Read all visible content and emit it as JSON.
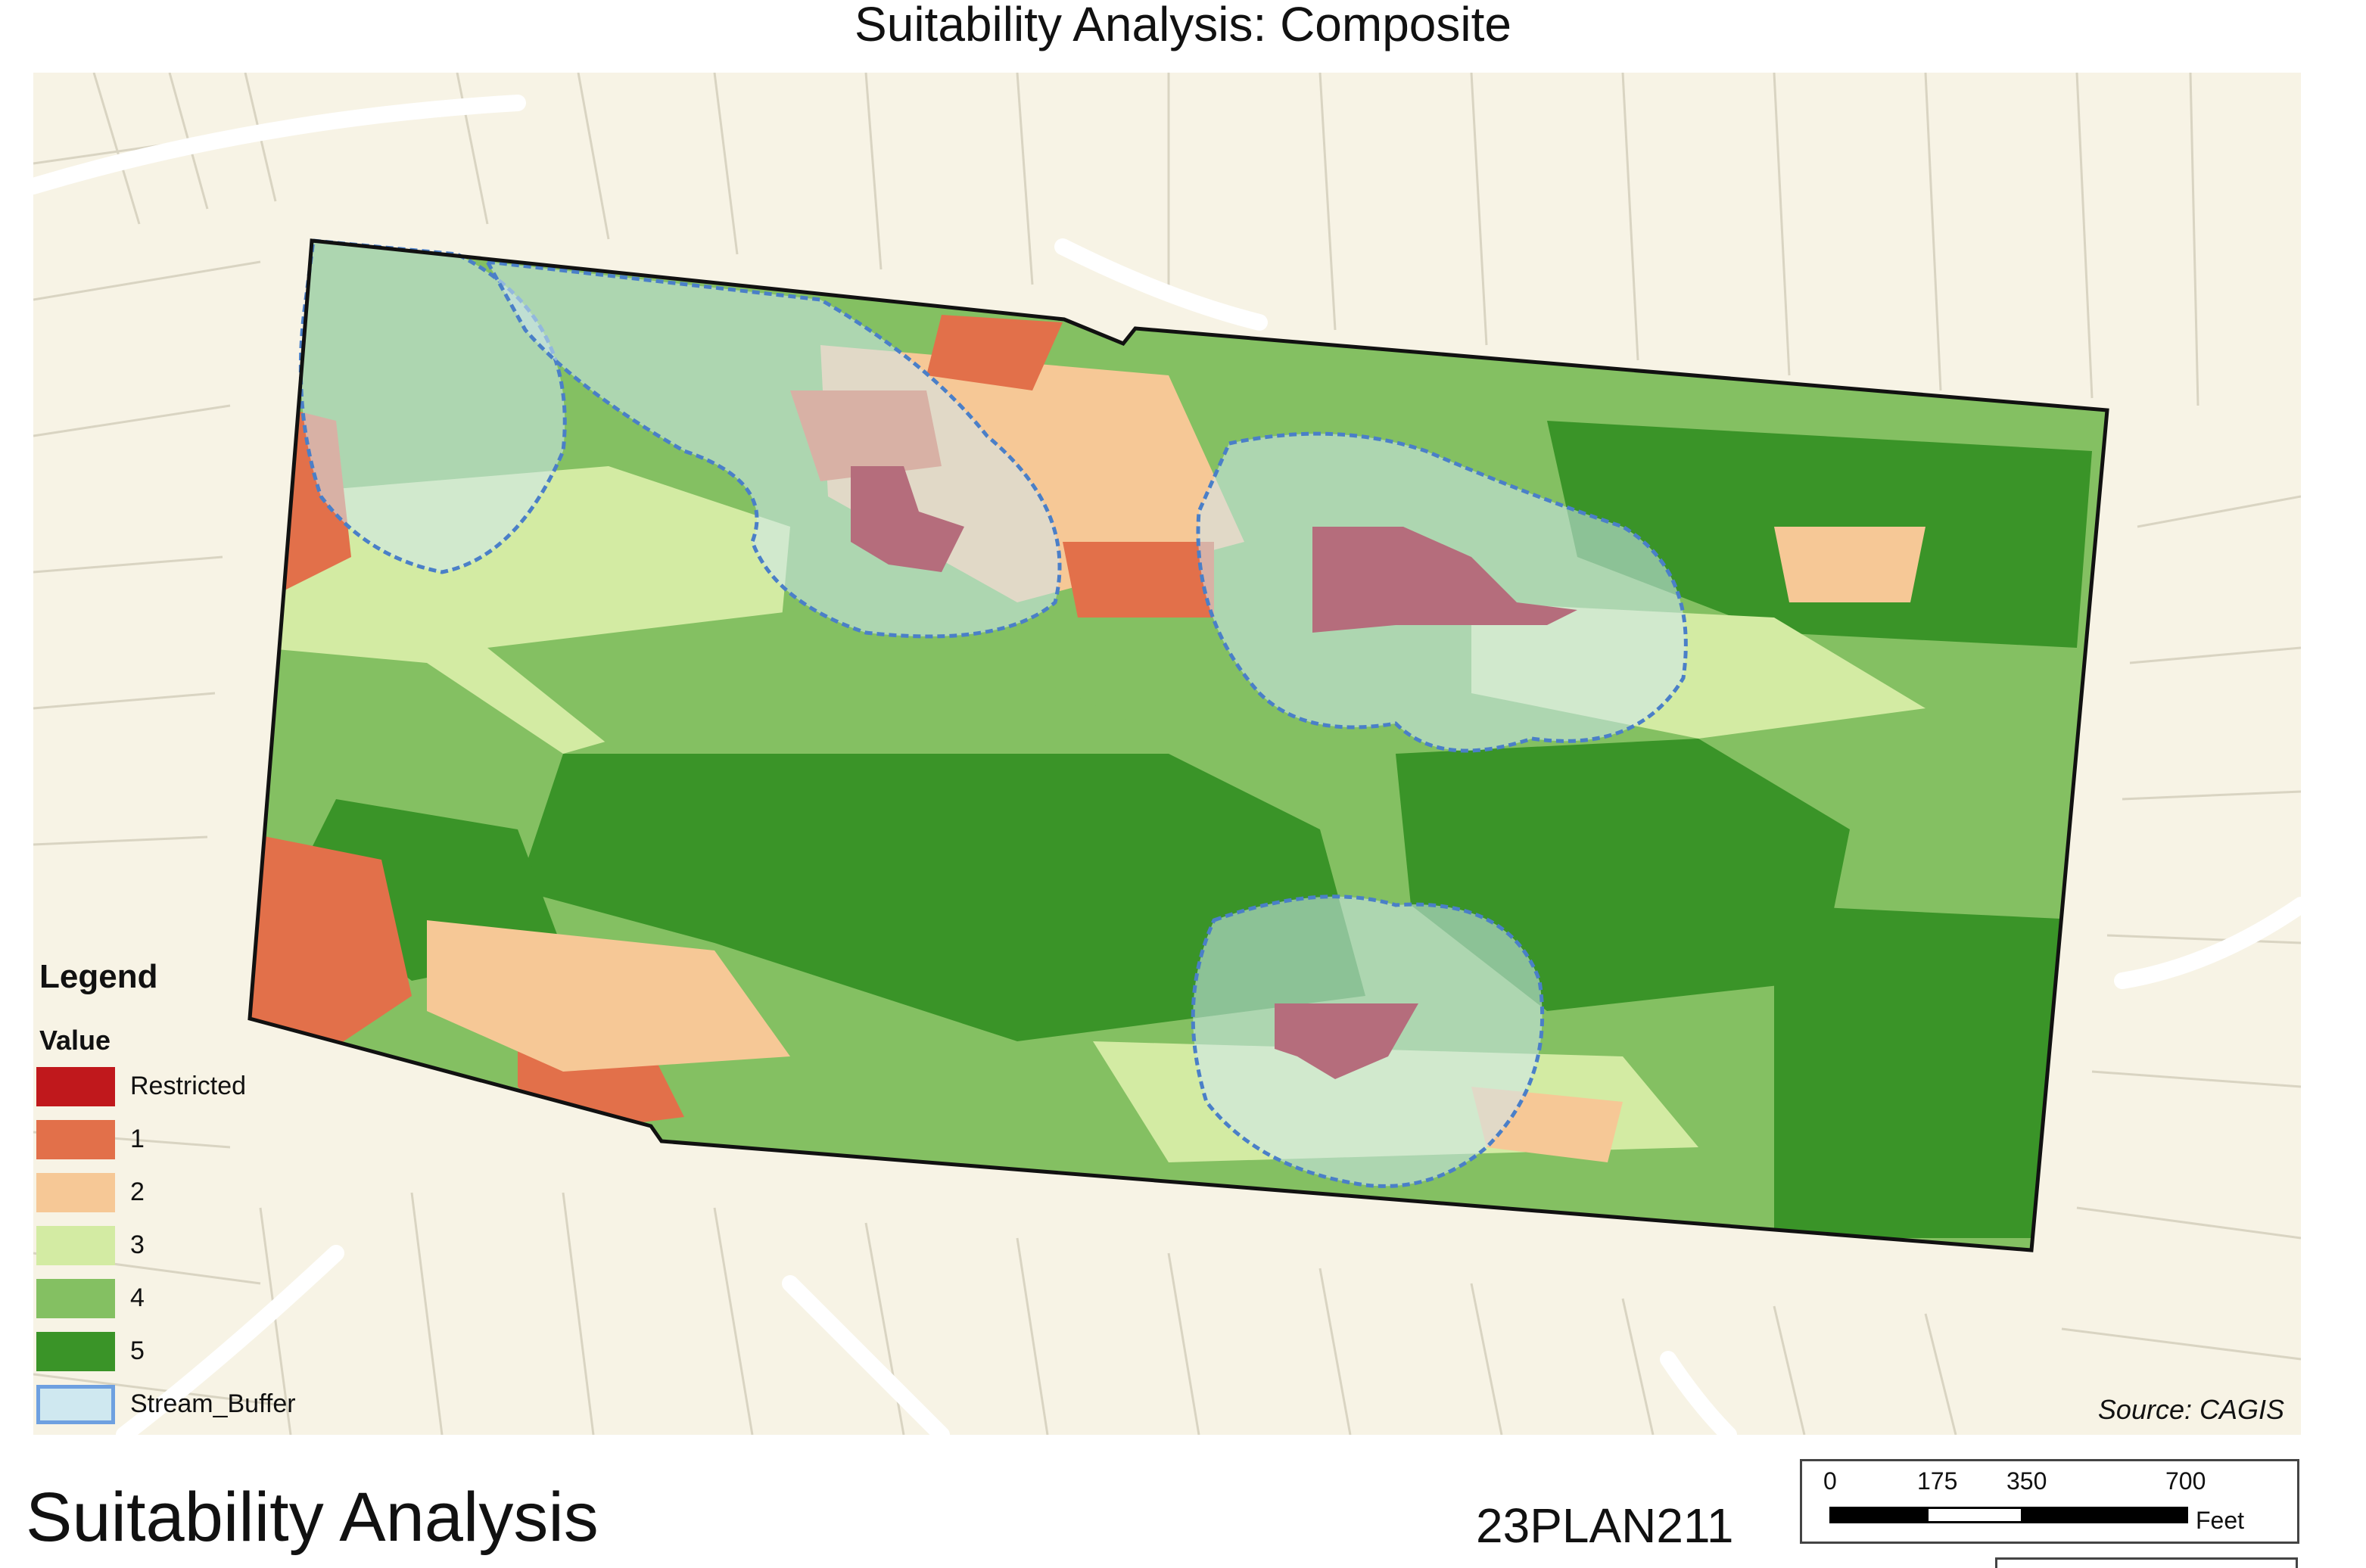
{
  "title": "Suitability Analysis: Composite",
  "colors": {
    "restricted": "#c0181c",
    "v1": "#e2704a",
    "v2": "#f6c896",
    "v3": "#d3eba3",
    "v4": "#84c062",
    "v5": "#3a9428",
    "buffer_fill": "#cfe8f0",
    "buffer_stroke": "#4a7fc8",
    "basemap": "#f7f3e5",
    "street": "#ffffff"
  },
  "legend": {
    "title": "Legend",
    "subtitle": "Value",
    "items": [
      {
        "label": "Restricted",
        "color": "#c0181c"
      },
      {
        "label": "1",
        "color": "#e2704a"
      },
      {
        "label": "2",
        "color": "#f6c896"
      },
      {
        "label": "3",
        "color": "#d3eba3"
      },
      {
        "label": "4",
        "color": "#84c062"
      },
      {
        "label": "5",
        "color": "#3a9428"
      },
      {
        "label": "Stream_Buffer",
        "color": "#cfe8f0"
      }
    ]
  },
  "source": "Source: CAGIS",
  "footer": {
    "title": "Suitability Analysis",
    "plan_id": "23PLAN211"
  },
  "scalebar": {
    "ticks": [
      "0",
      "175",
      "350",
      "700"
    ],
    "unit": "Feet"
  }
}
